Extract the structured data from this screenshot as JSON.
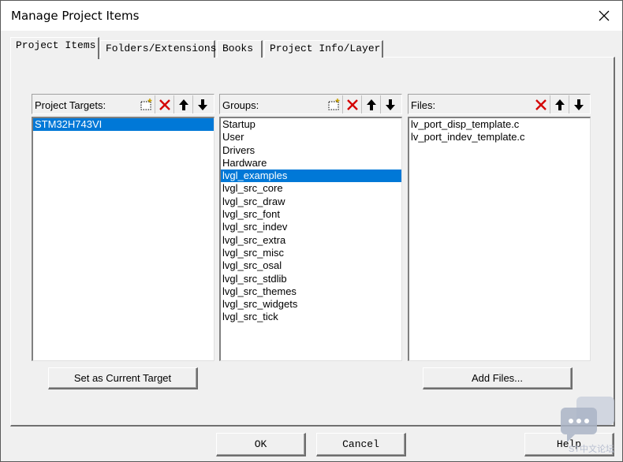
{
  "window": {
    "title": "Manage Project Items"
  },
  "tabs": [
    {
      "label": "Project Items",
      "active": true
    },
    {
      "label": "Folders/Extensions",
      "active": false
    },
    {
      "label": "Books",
      "active": false
    },
    {
      "label": "Project Info/Layer",
      "active": false
    }
  ],
  "targets": {
    "label": "Project Targets:",
    "items": [
      "STM32H743VI"
    ],
    "selected_index": 0
  },
  "groups": {
    "label": "Groups:",
    "items": [
      "Startup",
      "User",
      "Drivers",
      "Hardware",
      "lvgl_examples",
      "lvgl_src_core",
      "lvgl_src_draw",
      "lvgl_src_font",
      "lvgl_src_indev",
      "lvgl_src_extra",
      "lvgl_src_misc",
      "lvgl_src_osal",
      "lvgl_src_stdlib",
      "lvgl_src_themes",
      "lvgl_src_widgets",
      "lvgl_src_tick"
    ],
    "selected_index": 4
  },
  "files": {
    "label": "Files:",
    "items": [
      "lv_port_disp_template.c",
      "lv_port_indev_template.c"
    ]
  },
  "buttons": {
    "set_current_target": "Set as Current Target",
    "add_files": "Add Files...",
    "ok": "OK",
    "cancel": "Cancel",
    "help": "Help"
  },
  "icons": {
    "new": "new-item-icon",
    "delete": "delete-x-icon",
    "up": "arrow-up-icon",
    "down": "arrow-down-icon",
    "delete_color": "#d40000"
  },
  "watermark": {
    "text": "ST中文论坛"
  },
  "colors": {
    "selection": "#0078d7",
    "dialog_bg": "#f0f0f0"
  }
}
